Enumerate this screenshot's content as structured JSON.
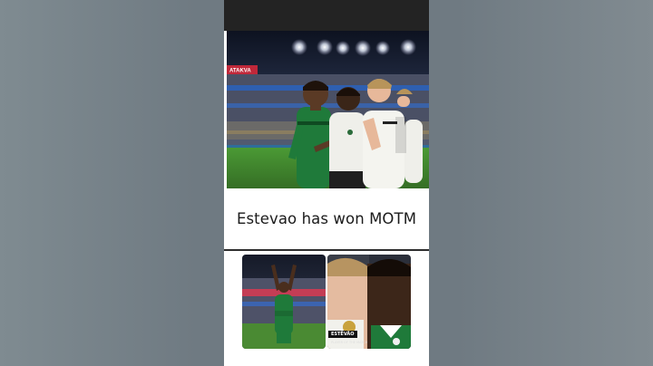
{
  "post": {
    "caption": "Estevao has won MOTM"
  },
  "thumbnails": {
    "right_badge_name": "ESTÊVÃO",
    "right_badge_sub": "PLAYER OF THE MATCH"
  },
  "stadium": {
    "board_text": "ATAKVA"
  },
  "colors": {
    "app_background": "#6f7a82",
    "top_bar": "#232323",
    "card": "#ffffff",
    "kit_green": "#1f7a3a",
    "kit_white": "#f2f2ee",
    "pitch": "#3f8a2e"
  }
}
